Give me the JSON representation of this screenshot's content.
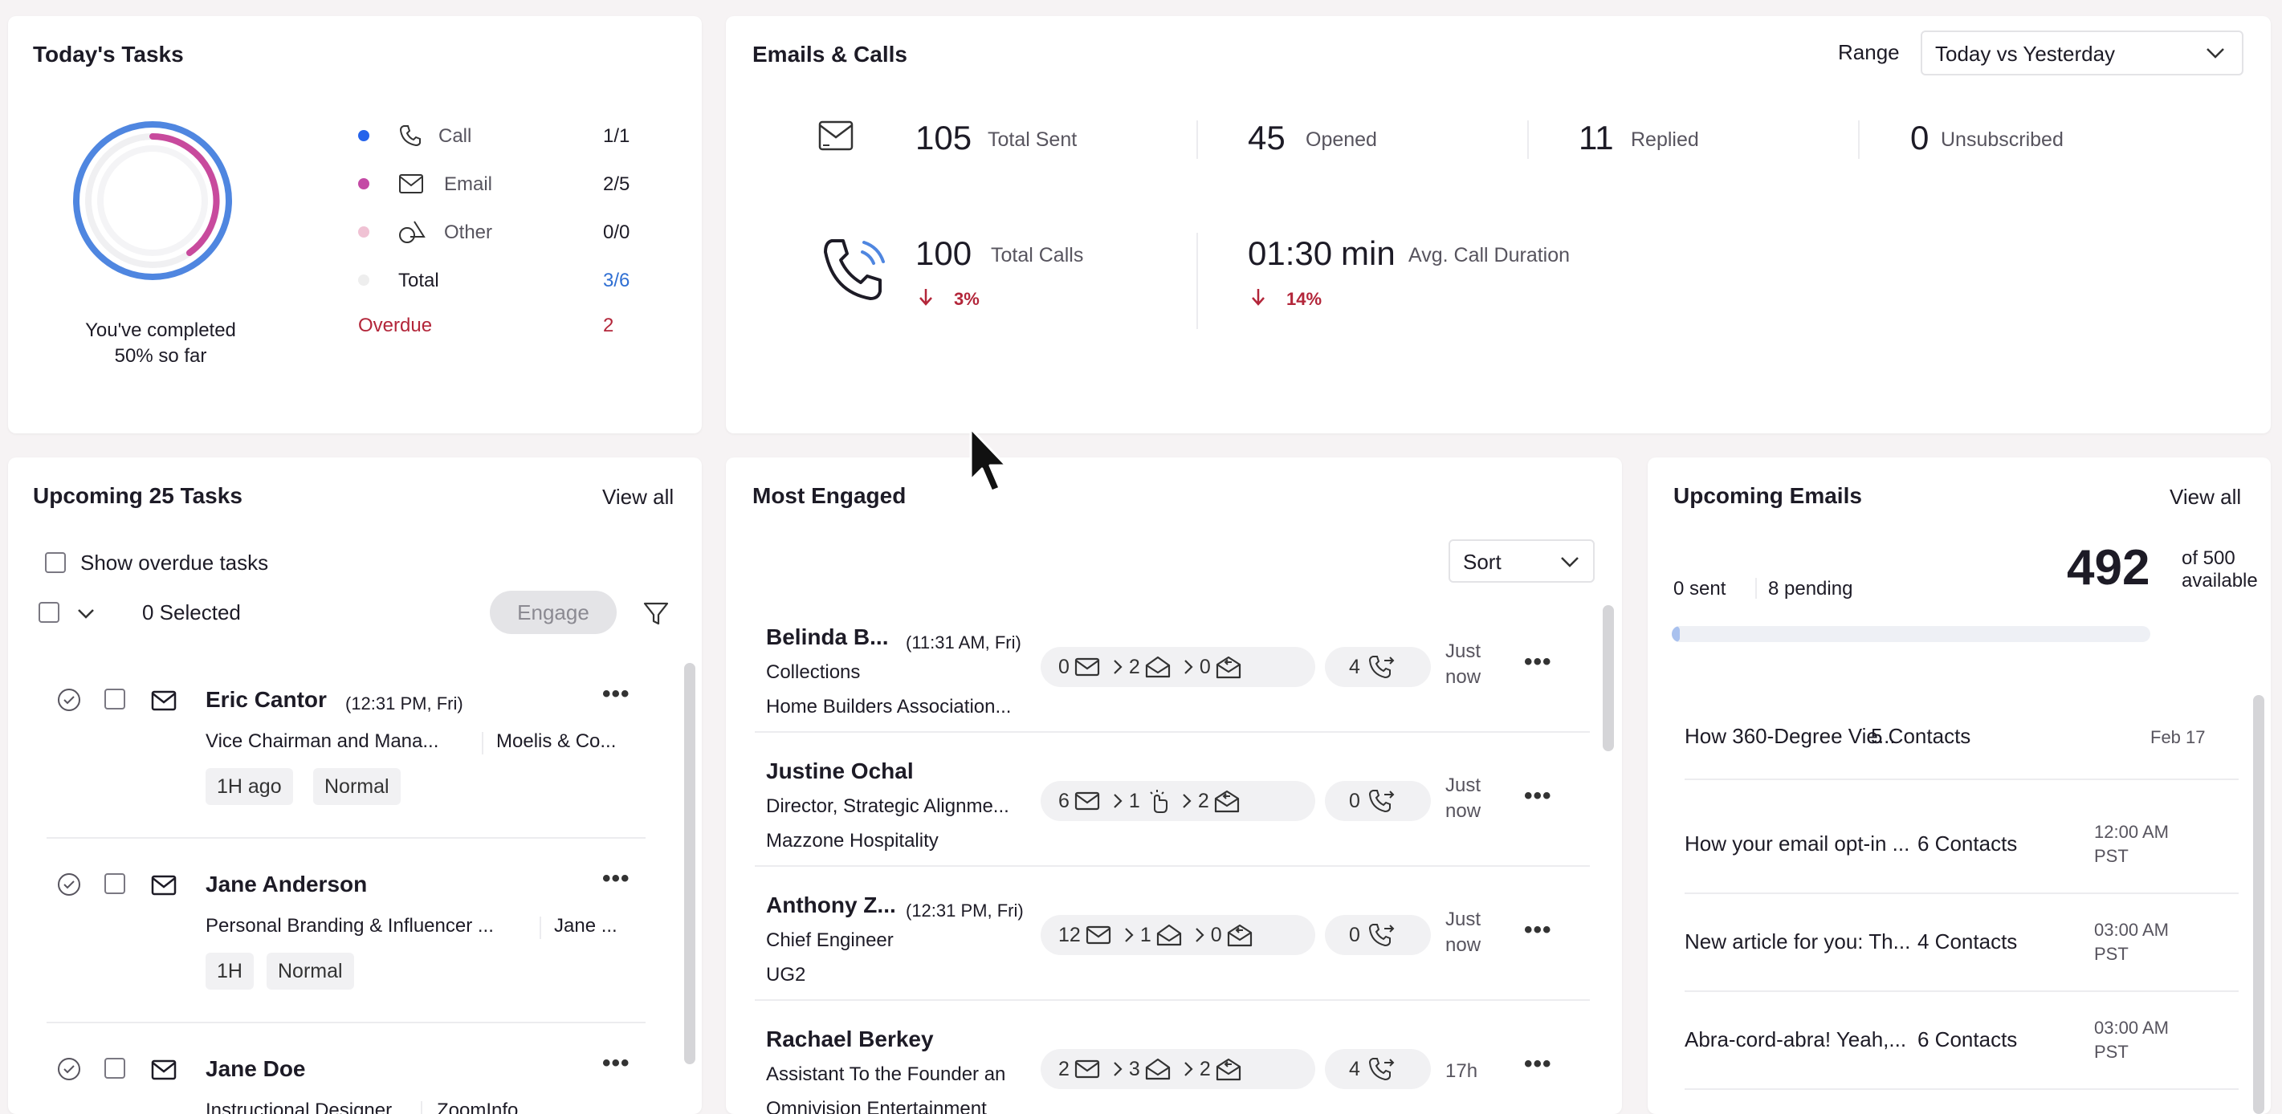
{
  "tasks": {
    "title": "Today's Tasks",
    "completed_line1": "You've completed",
    "completed_line2": "50% so far",
    "rows": [
      {
        "label": "Call",
        "value": "1/1",
        "dot": "#2563eb"
      },
      {
        "label": "Email",
        "value": "2/5",
        "dot": "#c44aa5"
      },
      {
        "label": "Other",
        "value": "0/0",
        "dot": "#f0c2d4"
      },
      {
        "label": "Total",
        "value": "3/6",
        "dot": "#eeeeee"
      }
    ],
    "overdue_label": "Overdue",
    "overdue_value": "2"
  },
  "emails_calls": {
    "title": "Emails & Calls",
    "range_label": "Range",
    "range_value": "Today vs Yesterday",
    "sent_value": "105",
    "sent_label": "Total Sent",
    "opened_value": "45",
    "opened_label": "Opened",
    "replied_value": "11",
    "replied_label": "Replied",
    "unsub_value": "0",
    "unsub_label": "Unsubscribed",
    "calls_value": "100",
    "calls_label": "Total Calls",
    "calls_change": "3%",
    "duration_value": "01:30",
    "duration_unit": "min",
    "duration_label": "Avg. Call Duration",
    "duration_change": "14%"
  },
  "upcoming_tasks": {
    "title": "Upcoming 25 Tasks",
    "view_all": "View all",
    "show_overdue": "Show overdue tasks",
    "selected": "0 Selected",
    "engage": "Engage",
    "items": [
      {
        "name": "Eric Cantor",
        "time": "(12:31 PM, Fri)",
        "role": "Vice Chairman and Mana...",
        "company": "Moelis & Co...",
        "tag1": "1H ago",
        "tag2": "Normal"
      },
      {
        "name": "Jane Anderson",
        "time": "",
        "role": "Personal Branding & Influencer ...",
        "company": "Jane ...",
        "tag1": "1H",
        "tag2": "Normal"
      },
      {
        "name": "Jane Doe",
        "time": "",
        "role": "Instructional Designer",
        "company": "ZoomInfo",
        "tag1": "",
        "tag2": ""
      }
    ]
  },
  "most_engaged": {
    "title": "Most Engaged",
    "sort": "Sort",
    "items": [
      {
        "name": "Belinda B...",
        "time": "(11:31 AM, Fri)",
        "role": "Collections",
        "company": "Home Builders Association...",
        "n1": "0",
        "n2": "2",
        "n3": "0",
        "calls": "4",
        "when1": "Just",
        "when2": "now"
      },
      {
        "name": "Justine Ochal",
        "time": "",
        "role": "Director, Strategic Alignme...",
        "company": "Mazzone Hospitality",
        "n1": "6",
        "n2": "1",
        "n3": "2",
        "calls": "0",
        "when1": "Just",
        "when2": "now"
      },
      {
        "name": "Anthony Z...",
        "time": "(12:31 PM, Fri)",
        "role": "Chief Engineer",
        "company": "UG2",
        "n1": "12",
        "n2": "1",
        "n3": "0",
        "calls": "0",
        "when1": "Just",
        "when2": "now"
      },
      {
        "name": "Rachael Berkey",
        "time": "",
        "role": "Assistant To the Founder an",
        "company": "Omnivision Entertainment",
        "n1": "2",
        "n2": "3",
        "n3": "2",
        "calls": "4",
        "when1": "17h",
        "when2": ""
      }
    ]
  },
  "upcoming_emails": {
    "title": "Upcoming Emails",
    "view_all": "View all",
    "sent": "0 sent",
    "pending": "8 pending",
    "available_value": "492",
    "available_of": "of 500",
    "available_label": "available",
    "progress_fraction": 0.016,
    "items": [
      {
        "subject": "How 360-Degree Vie...",
        "contacts": "5 Contacts",
        "date1": "Feb 17",
        "date2": ""
      },
      {
        "subject": "How your email opt-in ...",
        "contacts": "6 Contacts",
        "date1": "12:00 AM",
        "date2": "PST"
      },
      {
        "subject": "New article for you: Th...",
        "contacts": "4 Contacts",
        "date1": "03:00 AM",
        "date2": "PST"
      },
      {
        "subject": "Abra-cord-abra! Yeah,...",
        "contacts": "6 Contacts",
        "date1": "03:00 AM",
        "date2": "PST"
      }
    ]
  },
  "colors": {
    "ring_blue": "#4f86e0",
    "ring_pink": "#c84a9d",
    "overdue": "#b3263a",
    "total_link": "#2f6fd3"
  }
}
